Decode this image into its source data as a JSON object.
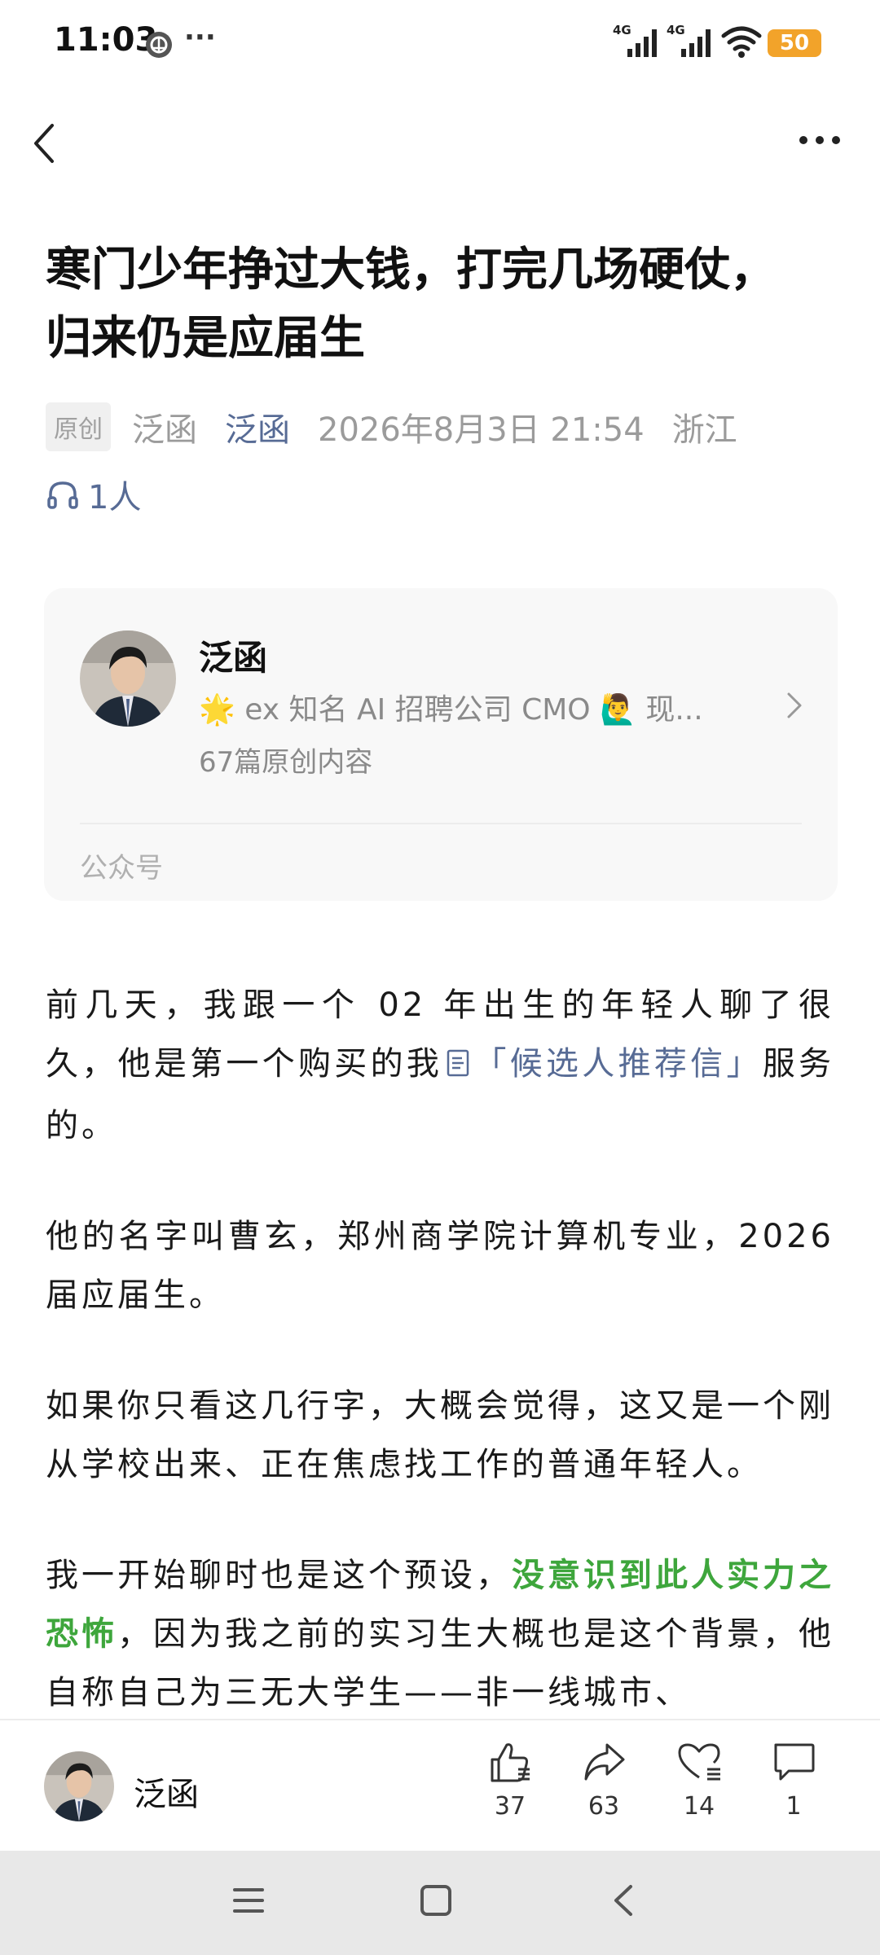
{
  "status_bar": {
    "time": "11:03",
    "more": "···",
    "signal1_label": "4G",
    "signal2_label": "4G",
    "battery": "50"
  },
  "header": {
    "back_icon": "chevron-left-icon",
    "more_icon": "ellipsis-icon"
  },
  "article": {
    "title": "寒门少年挣过大钱，打完几场硬仗，归来仍是应届生",
    "badge": "原创",
    "author": "泛函",
    "account_link": "泛函",
    "date": "2026年8月3日 21:54",
    "location": "浙江",
    "listeners": "1人"
  },
  "profile_card": {
    "name": "泛函",
    "description": "🌟 ex 知名 AI 招聘公司 CMO 🙋‍♂️ 现...",
    "count": "67篇原创内容",
    "footer": "公众号"
  },
  "body": {
    "p1_a": "前几天，我跟一个 02 年出生的年轻人聊了很久，他是第一个购买的我",
    "p1_link": "「候选人推荐信」",
    "p1_b": "服务的。",
    "p2": "他的名字叫曹玄，郑州商学院计算机专业，2026 届应届生。",
    "p3": "如果你只看这几行字，大概会觉得，这又是一个刚从学校出来、正在焦虑找工作的普通年轻人。",
    "p4_a": "我一开始聊时也是这个预设，",
    "p4_highlight": "没意识到此人实力之恐怖",
    "p4_b": "，因为我之前的实习生大概也是这个背景，他自称自己为三无大学生——非一线城市、"
  },
  "bottom_bar": {
    "author": "泛函",
    "like_count": "37",
    "share_count": "63",
    "favorite_count": "14",
    "comment_count": "1"
  }
}
